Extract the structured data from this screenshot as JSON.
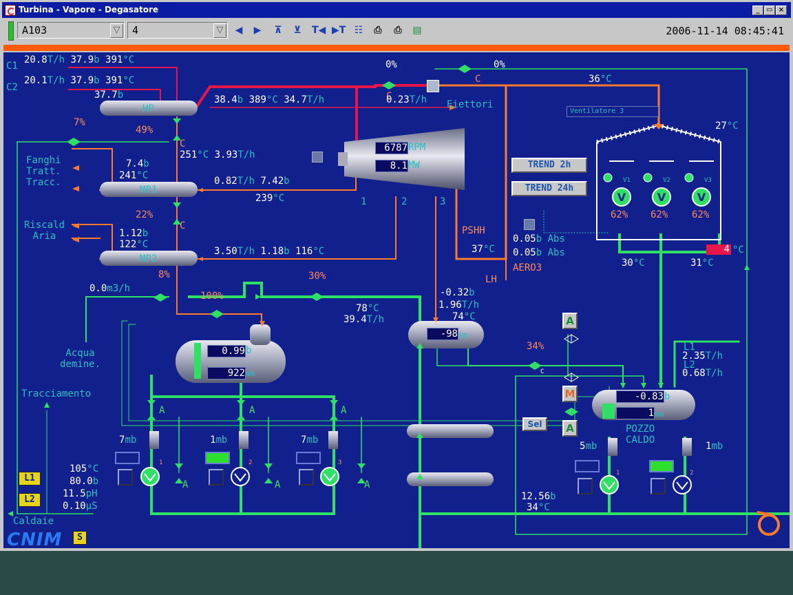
{
  "window": {
    "title": "Turbina - Vapore - Degasatore",
    "buttons": [
      "_",
      "▭",
      "×"
    ]
  },
  "toolbar": {
    "combo1": "A103",
    "combo2": "4",
    "datetime": "2006-11-14 08:45:41",
    "icons": [
      "arrow-left-icon",
      "arrow-right-icon",
      "tree-up-icon",
      "tree-down-icon",
      "first-icon",
      "last-icon",
      "hierarchy-icon",
      "print-icon",
      "print2-icon",
      "trash-icon"
    ]
  },
  "colors": {
    "background": "#11208c",
    "steam": "#ff7a2a",
    "water": "#2ee064",
    "hot": "#e6154a",
    "value": "#ffffff",
    "unit": "#29c0c0"
  },
  "inputs": {
    "c1": {
      "label": "C1",
      "flow": "20.8",
      "flow_u": "T/h",
      "press": "37.9",
      "press_u": "b",
      "temp": "391",
      "temp_u": "°C"
    },
    "c2": {
      "label": "C2",
      "flow": "20.1",
      "flow_u": "T/h",
      "press": "37.9",
      "press_u": "b",
      "temp": "391",
      "temp_u": "°C"
    },
    "hp_press": "37.7",
    "hp_press_u": "b"
  },
  "headers": {
    "hp": "HP",
    "mp1": "MP1",
    "mp2": "MP2"
  },
  "hp_out": {
    "press": "38.4",
    "temp": "389",
    "flow": "34.7"
  },
  "ejector": {
    "valve1_pct": "0%",
    "valve2_pct": "0%",
    "flow": "0.23",
    "label": "Eiettori",
    "c1": "C",
    "c2": "C",
    "temp": "36"
  },
  "left": {
    "v7": "7%",
    "v49": "49%",
    "c": "C",
    "temp251": "251",
    "flow393": "3.93",
    "fanghi": "Fanghi\nTratt.\nTracc.",
    "mp1_press": "7.4",
    "mp1_temp": "241",
    "mp1_in_flow": "0.82",
    "mp1_in_press": "7.42",
    "mp1_in_temp": "239",
    "v22": "22%",
    "c2": "C",
    "riscald": "Riscald\nAria",
    "mp2_press": "1.12",
    "mp2_temp": "122",
    "mp2_flow": "3.50",
    "mp2_in_press": "1.18",
    "mp2_in_temp": "116",
    "v8": "8%"
  },
  "turbine": {
    "rpm": "6787",
    "rpm_u": "RPM",
    "mw": "8.1",
    "mw_u": "MW",
    "ext1": "1",
    "ext2": "2",
    "ext3": "3"
  },
  "pshh": {
    "label": "PSHH",
    "temp": "37",
    "abs1": "0.05",
    "abs2": "0.05",
    "abs_u": "b Abs",
    "aero": "AERO3",
    "lh": "LH"
  },
  "trend": {
    "t2h": "TREND 2h",
    "t24h": "TREND 24h"
  },
  "aero": {
    "title": "Ventilatore 3",
    "fans": [
      {
        "id": "V1",
        "pct": "62%"
      },
      {
        "id": "V2",
        "pct": "62%"
      },
      {
        "id": "V3",
        "pct": "62%"
      }
    ],
    "temp_in": "27",
    "out1": "30",
    "out2": "31",
    "alarm": "4"
  },
  "demin": {
    "flow": "0.0",
    "flow_u": "m3/h",
    "label": "Acqua\ndemine.",
    "v100": "100%",
    "v30": "30%"
  },
  "degasser": {
    "press": "0.99",
    "level": "922",
    "level_u": "mm",
    "flow_temp": "78",
    "flow": "39.4"
  },
  "tracciamento": "Tracciamento",
  "feed_pumps": [
    {
      "mb": "7",
      "num": "1",
      "status": "off"
    },
    {
      "mb": "1",
      "num": "2",
      "status": "on"
    },
    {
      "mb": "7",
      "num": "3",
      "status": "off"
    }
  ],
  "boiler": {
    "temp": "105",
    "press": "80.0",
    "ph": "11.5",
    "cond": "0.10",
    "caldaie": "Caldaie",
    "l1": "L1",
    "l2": "L2"
  },
  "condenser_hx": {
    "press": "-0.32",
    "flow": "1.96",
    "temp": "74",
    "level": "-98"
  },
  "hotwell": {
    "v34": "34%",
    "c": "C",
    "press": "-0.83",
    "level": "1",
    "title": "POZZO\nCALDO",
    "l1_label": "L1",
    "l1": "2.35",
    "l2_label": "L2",
    "l2": "0.68",
    "pump1_mb": "5",
    "pump2_mb": "1",
    "pump1_num": "1",
    "pump2_num": "2",
    "out_press": "12.56",
    "out_temp": "34",
    "a": "A",
    "m": "M",
    "sel": "Sel"
  },
  "brand": {
    "name": "CNIM",
    "s": "S"
  }
}
